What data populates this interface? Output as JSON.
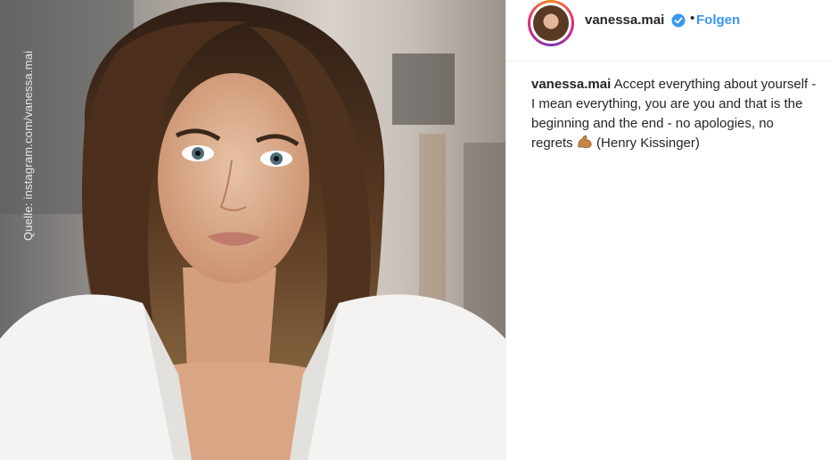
{
  "photo": {
    "watermark": "Quelle: instagram.com/vanessa.mai"
  },
  "header": {
    "username": "vanessa.mai",
    "separator": "•",
    "follow_label": "Folgen",
    "verified_icon": "verified-badge-icon",
    "accent_color": "#3897f0"
  },
  "caption": {
    "username": "vanessa.mai",
    "text_before_emoji": "Accept everything about yourself - I mean everything, you are you and that is the beginning and the end - no apologies, no regrets",
    "emoji": "flexed-biceps-icon",
    "text_after_emoji": "(Henry Kissinger)"
  }
}
